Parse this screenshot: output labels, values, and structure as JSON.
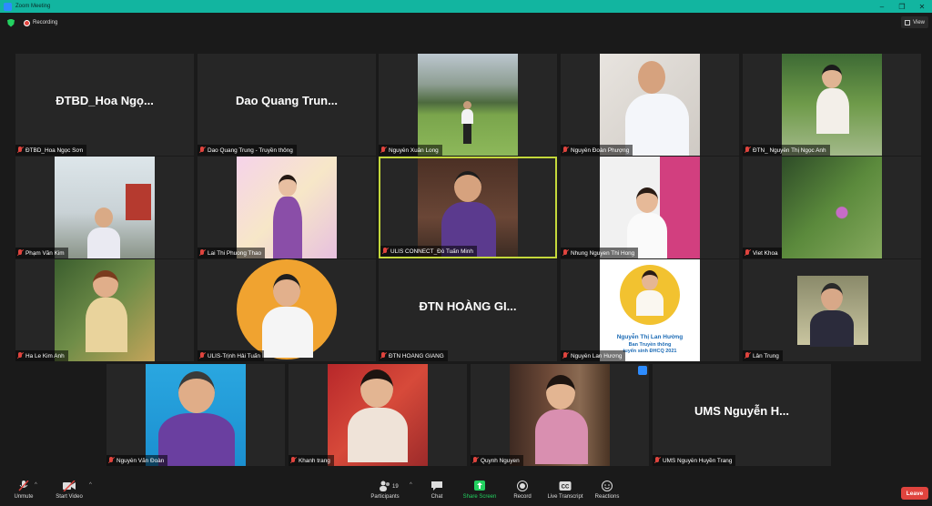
{
  "window": {
    "title": "Zoom Meeting",
    "min": "–",
    "max": "❐",
    "close": "✕"
  },
  "topbar": {
    "recording": "Recording",
    "view": "View"
  },
  "tiles": [
    {
      "big": "ĐTBD_Hoa  Ngọ...",
      "label": "ĐTBD_Hoa Ngọc Sơn"
    },
    {
      "big": "Dao Quang Trun...",
      "label": "Dao Quang Trung - Truyền thông"
    },
    {
      "label": "Nguyễn Xuân Long"
    },
    {
      "label": "Nguyễn Đoàn Phượng"
    },
    {
      "label": "ĐTN_ Nguyễn Thị Ngọc Anh"
    },
    {
      "label": "Phạm Văn Kim"
    },
    {
      "label": "Lai Thi Phuong Thao"
    },
    {
      "label": "ULIS CONNECT_Đỗ Tuấn Minh"
    },
    {
      "label": "Nhung Nguyen Thi Hong"
    },
    {
      "label": "Viet Khoa"
    },
    {
      "label": "Ha Le Kim Anh"
    },
    {
      "label": "ULIS-Trịnh Hải Tuấn"
    },
    {
      "big": "ĐTN HOÀNG GI...",
      "label": "ĐTN HOÀNG GIANG"
    },
    {
      "label": "Nguyễn Lan Hương",
      "card_name": "Nguyễn Thị Lan Hường",
      "card_line1": "Ban Truyền thông",
      "card_line2": "tuyển sinh ĐHCQ 2021"
    },
    {
      "label": "Lân Trung"
    },
    {
      "label": "Nguyễn Văn Đoàn"
    },
    {
      "label": "Khanh trang"
    },
    {
      "label": "Quynh Nguyen"
    },
    {
      "big": "UMS Nguyễn H...",
      "label": "UMS Nguyễn Huyền Trang"
    }
  ],
  "toolbar": {
    "unmute": "Unmute",
    "start_video": "Start Video",
    "participants": "Participants",
    "participants_count": "19",
    "chat": "Chat",
    "share_screen": "Share Screen",
    "record": "Record",
    "live_transcript": "Live Transcript",
    "reactions": "Reactions",
    "leave": "Leave"
  },
  "colors": {
    "titlebar": "#12b5a0",
    "active_speaker": "#c4d83b",
    "muted": "#e0443e",
    "share": "#23d160"
  }
}
